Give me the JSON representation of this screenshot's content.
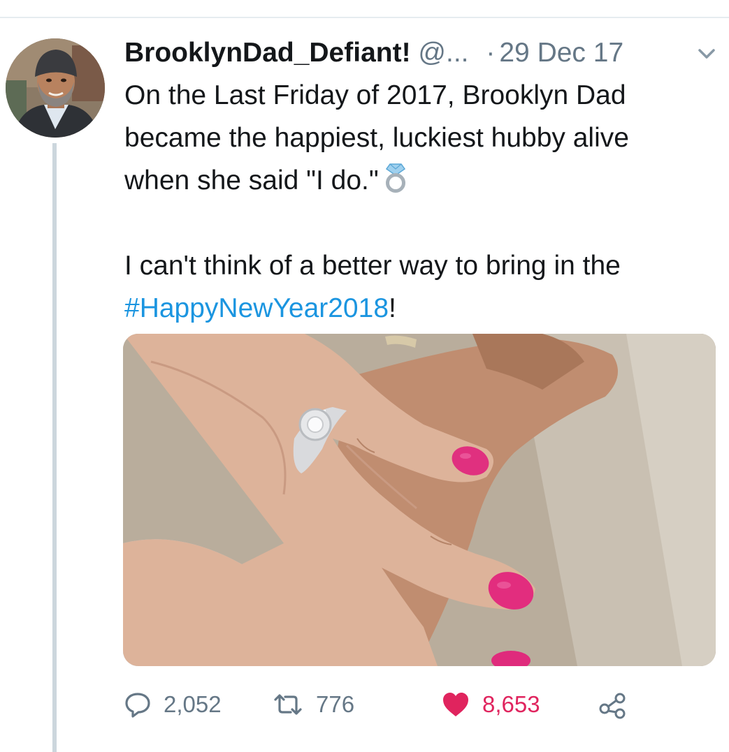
{
  "tweet": {
    "author": {
      "display_name": "BrooklynDad_Defiant!",
      "handle": "@..."
    },
    "separator": "·",
    "date": "29 Dec 17",
    "text_lines": [
      "On the Last Friday of 2017, Brooklyn Dad",
      "became the happiest, luckiest hubby alive",
      "when she said \"I do.\""
    ],
    "text_line_4": "I can't think of a better way to bring in the",
    "hashtag": "#HappyNewYear2018",
    "hashtag_suffix": "!",
    "emoji": "ring-icon",
    "media_description_icon": "photo-of-hands-with-ring"
  },
  "actions": {
    "reply_count": "2,052",
    "retweet_count": "776",
    "like_count": "8,653",
    "icons": [
      "reply-icon",
      "retweet-icon",
      "heart-icon",
      "share-icon"
    ]
  },
  "colors": {
    "text": "#14171a",
    "secondary": "#657786",
    "link": "#1b95e0",
    "like": "#e0245e",
    "thread_line": "#ccd6dd"
  }
}
